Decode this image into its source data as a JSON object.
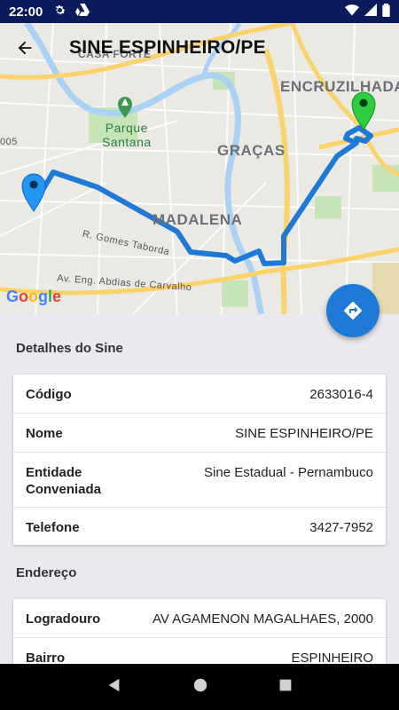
{
  "status_bar": {
    "time": "22:00"
  },
  "app_bar": {
    "title": "SINE ESPINHEIRO/PE"
  },
  "map": {
    "districts": {
      "casa_forte": "CASA FORTE",
      "encruzilhada": "ENCRUZILHADA",
      "gracas": "GRAÇAS",
      "madalena": "MADALENA"
    },
    "park": {
      "line1": "Parque",
      "line2": "Santana"
    },
    "streets": {
      "gomes_taborda": "R. Gomes Taborda",
      "abdias": "Av. Eng. Abdias de Carvalho",
      "code": "005"
    },
    "logo": [
      "G",
      "o",
      "o",
      "g",
      "l",
      "e"
    ],
    "route_color": "#1e7ad6",
    "origin_pin_color": "#2196f3",
    "destination_pin_color": "#2ecc40"
  },
  "details": {
    "section_title": "Detalhes do Sine",
    "rows": [
      {
        "label": "Código",
        "value": "2633016-4"
      },
      {
        "label": "Nome",
        "value": "SINE ESPINHEIRO/PE"
      },
      {
        "label_line1": "Entidade",
        "label_line2": "Conveniada",
        "value": "Sine Estadual - Pernambuco"
      },
      {
        "label": "Telefone",
        "value": "3427-7952"
      }
    ]
  },
  "address": {
    "section_title": "Endereço",
    "rows": [
      {
        "label": "Logradouro",
        "value": "AV AGAMENON MAGALHAES, 2000"
      },
      {
        "label": "Bairro",
        "value": "ESPINHEIRO"
      }
    ]
  }
}
